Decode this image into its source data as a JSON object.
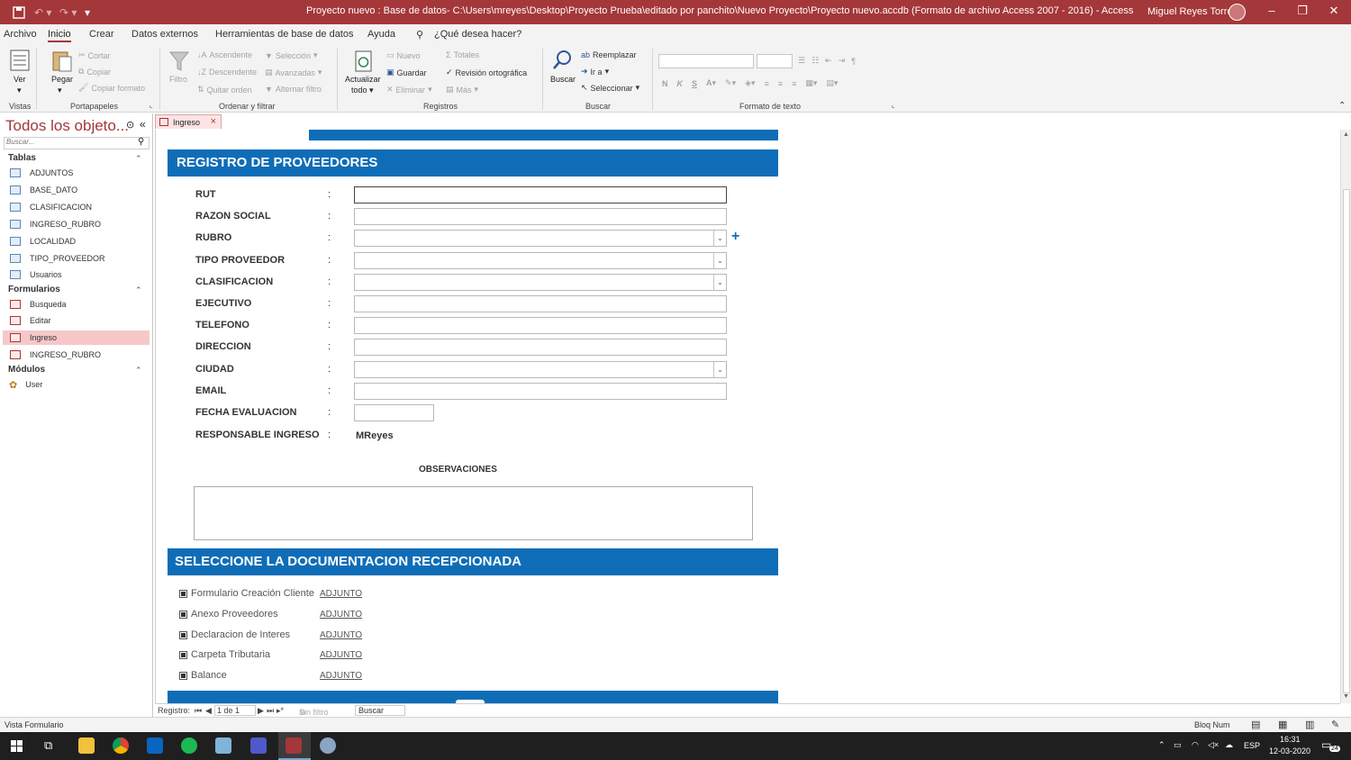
{
  "window": {
    "title": "Proyecto nuevo : Base de datos- C:\\Users\\mreyes\\Desktop\\Proyecto Prueba\\editado por panchito\\Nuevo Proyecto\\Proyecto nuevo.accdb (Formato de archivo Access 2007 - 2016)  -  Access",
    "user": "Miguel Reyes Torres",
    "accent_color": "#a4373a"
  },
  "tabs": [
    "Archivo",
    "Inicio",
    "Crear",
    "Datos externos",
    "Herramientas de base de datos",
    "Ayuda",
    "¿Qué desea hacer?"
  ],
  "ribbon": {
    "vistas": {
      "label": "Vistas",
      "ver": "Ver"
    },
    "portapapeles": {
      "label": "Portapapeles",
      "pegar": "Pegar",
      "cortar": "Cortar",
      "copiar": "Copiar",
      "copiar_formato": "Copiar formato"
    },
    "ordenar": {
      "label": "Ordenar y filtrar",
      "filtro": "Filtro",
      "ascendente": "Ascendente",
      "descendente": "Descendente",
      "quitar_orden": "Quitar orden",
      "seleccion": "Selección",
      "avanzadas": "Avanzadas",
      "alternar_filtro": "Alternar filtro"
    },
    "registros": {
      "label": "Registros",
      "actualizar": "Actualizar",
      "todo": "todo",
      "nuevo": "Nuevo",
      "guardar": "Guardar",
      "eliminar": "Eliminar",
      "totales": "Totales",
      "revision": "Revisión ortográfica",
      "mas": "Más"
    },
    "buscar": {
      "label": "Buscar",
      "buscar": "Buscar",
      "reemplazar": "Reemplazar",
      "ir_a": "Ir a",
      "seleccionar": "Seleccionar"
    },
    "formato": {
      "label": "Formato de texto",
      "n": "N",
      "k": "K",
      "s": "S"
    }
  },
  "nav": {
    "title": "Todos los objeto...",
    "search_placeholder": "Buscar...",
    "sections": [
      {
        "name": "Tablas",
        "items": [
          "ADJUNTOS",
          "BASE_DATO",
          "CLASIFICACION",
          "INGRESO_RUBRO",
          "LOCALIDAD",
          "TIPO_PROVEEDOR",
          "Usuarios"
        ]
      },
      {
        "name": "Formularios",
        "items": [
          "Busqueda",
          "Editar",
          "Ingreso",
          "INGRESO_RUBRO"
        ]
      },
      {
        "name": "Módulos",
        "items": [
          "User"
        ]
      }
    ],
    "selected": "Ingreso"
  },
  "doc_tab": "Ingreso",
  "form": {
    "header": "REGISTRO DE PROVEEDORES",
    "fields": [
      {
        "label": "RUT",
        "type": "text"
      },
      {
        "label": "RAZON SOCIAL",
        "type": "text"
      },
      {
        "label": "RUBRO",
        "type": "combo"
      },
      {
        "label": "TIPO PROVEEDOR",
        "type": "combo"
      },
      {
        "label": "CLASIFICACION",
        "type": "combo"
      },
      {
        "label": "EJECUTIVO",
        "type": "text"
      },
      {
        "label": "TELEFONO",
        "type": "text"
      },
      {
        "label": "DIRECCION",
        "type": "text"
      },
      {
        "label": "CIUDAD",
        "type": "combo"
      },
      {
        "label": "EMAIL",
        "type": "text"
      },
      {
        "label": "FECHA EVALUACION",
        "type": "short"
      }
    ],
    "responsable_label": "RESPONSABLE INGRESO",
    "responsable_value": "MReyes",
    "observaciones_label": "OBSERVACIONES",
    "doc_header": "SELECCIONE LA DOCUMENTACION RECEPCIONADA",
    "documents": [
      {
        "label": "Formulario Creación Cliente",
        "link": "ADJUNTO"
      },
      {
        "label": "Anexo Proveedores",
        "link": "ADJUNTO"
      },
      {
        "label": "Declaracion de Interes",
        "link": "ADJUNTO"
      },
      {
        "label": "Carpeta Tributaria",
        "link": "ADJUNTO"
      },
      {
        "label": "Balance",
        "link": "ADJUNTO"
      }
    ],
    "header_color": "#0f6db7"
  },
  "record_nav": {
    "label": "Registro:",
    "position": "1 de 1",
    "filter": "Sin filtro",
    "search": "Buscar"
  },
  "status": {
    "left": "Vista Formulario",
    "right": "Bloq Num"
  },
  "taskbar": {
    "lang": "ESP",
    "time": "16:31",
    "date": "12-03-2020",
    "notif": "24"
  }
}
